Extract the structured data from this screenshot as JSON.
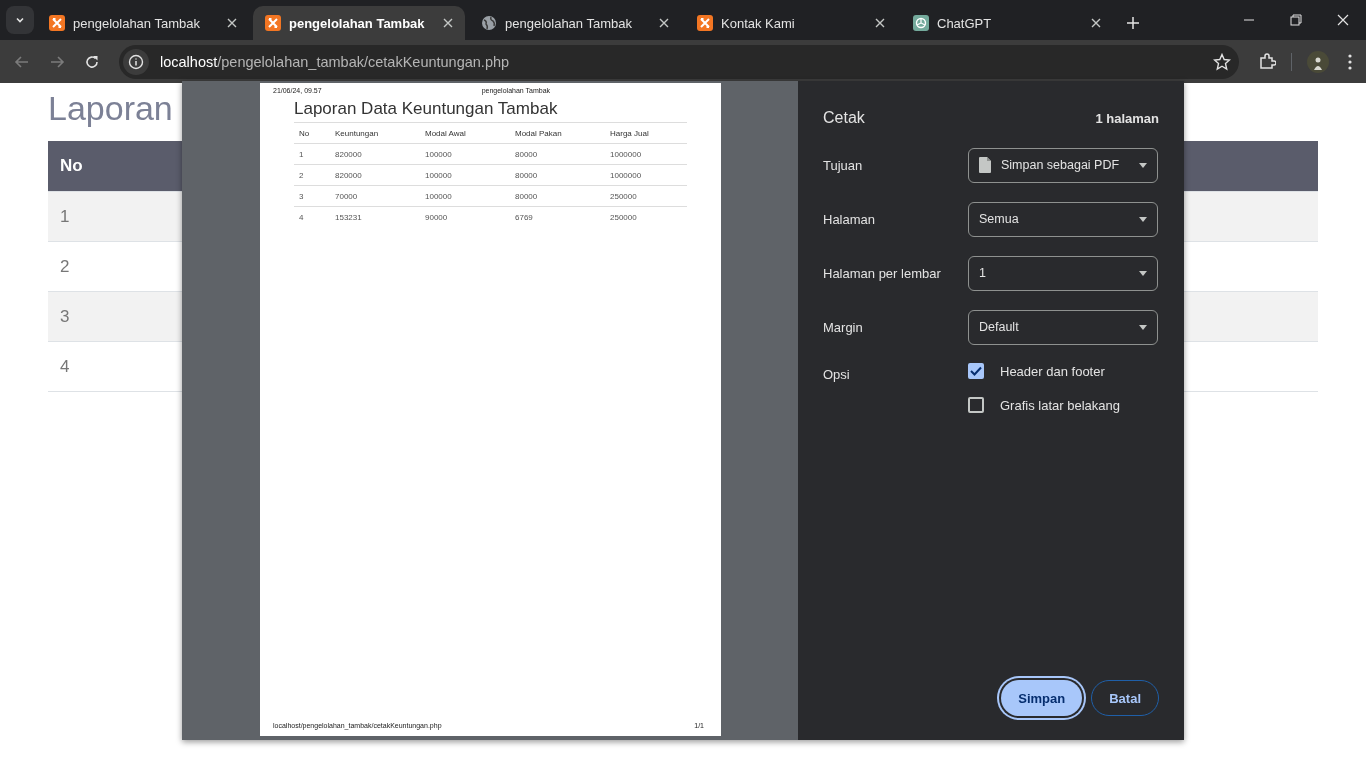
{
  "browser": {
    "tabs": [
      {
        "title": "pengelolahan Tambak",
        "kind": "xampp",
        "selected": false
      },
      {
        "title": "pengelolahan Tambak",
        "kind": "xampp",
        "selected": true
      },
      {
        "title": "pengelolahan Tambak",
        "kind": "globe",
        "selected": false
      },
      {
        "title": "Kontak Kami",
        "kind": "xampp",
        "selected": false
      },
      {
        "title": "ChatGPT",
        "kind": "chatgpt",
        "selected": false
      }
    ],
    "address_host": "localhost",
    "address_path": "/pengelolahan_tambak/cetakKeuntungan.php"
  },
  "page": {
    "heading": "Laporan",
    "columns": [
      "No"
    ],
    "rows": [
      [
        "1"
      ],
      [
        "2"
      ],
      [
        "3"
      ],
      [
        "4"
      ]
    ]
  },
  "print_dialog": {
    "preview": {
      "header_left": "21/06/24, 09.57",
      "header_center": "pengelolahan Tambak",
      "title": "Laporan Data Keuntungan Tambak",
      "columns": [
        "No",
        "Keuntungan",
        "Modal Awal",
        "Modal Pakan",
        "Harga Jual"
      ],
      "rows": [
        [
          "1",
          "820000",
          "100000",
          "80000",
          "1000000"
        ],
        [
          "2",
          "820000",
          "100000",
          "80000",
          "1000000"
        ],
        [
          "3",
          "70000",
          "100000",
          "80000",
          "250000"
        ],
        [
          "4",
          "153231",
          "90000",
          "6769",
          "250000"
        ]
      ],
      "footer_left": "localhost/pengelolahan_tambak/cetakKeuntungan.php",
      "footer_right": "1/1"
    },
    "settings": {
      "title": "Cetak",
      "page_count": "1 halaman",
      "fields": [
        {
          "label": "Tujuan",
          "value": "Simpan sebagai PDF",
          "kind": "destination"
        },
        {
          "label": "Halaman",
          "value": "Semua",
          "kind": "plain"
        },
        {
          "label": "Halaman per lembar",
          "value": "1",
          "kind": "plain"
        },
        {
          "label": "Margin",
          "value": "Default",
          "kind": "plain"
        }
      ],
      "options_label": "Opsi",
      "options": [
        {
          "label": "Header dan footer",
          "checked": true
        },
        {
          "label": "Grafis latar belakang",
          "checked": false
        }
      ],
      "buttons": [
        {
          "label": "Simpan",
          "kind": "primary"
        },
        {
          "label": "Batal",
          "kind": "secondary"
        }
      ]
    }
  }
}
